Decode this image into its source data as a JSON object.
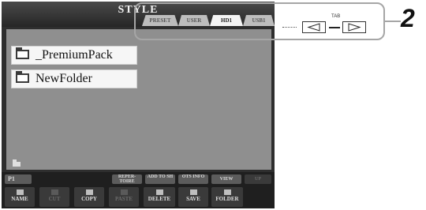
{
  "screen": {
    "title": "STYLE",
    "tabs": [
      {
        "label": "PRESET",
        "active": false
      },
      {
        "label": "USER",
        "active": false
      },
      {
        "label": "HD1",
        "active": true
      },
      {
        "label": "USB1",
        "active": false
      }
    ],
    "files": [
      "_PremiumPack",
      "NewFolder"
    ],
    "upper_buttons": [
      "P1",
      "REPER-TOIRE",
      "ADD TO SH",
      "OTS INFO",
      "VIEW",
      "UP"
    ],
    "lower_buttons": [
      "NAME",
      "CUT",
      "COPY",
      "PASTE",
      "DELETE",
      "SAVE",
      "FOLDER"
    ]
  },
  "callout": {
    "tab_label": "TAB",
    "left_icon": "triangle-left-icon",
    "right_icon": "triangle-right-icon",
    "step_number": "2"
  },
  "colors": {
    "screen_bg": "#2e2e2e",
    "file_area": "#8f8f8f",
    "callout_border": "#a6a6a6"
  }
}
